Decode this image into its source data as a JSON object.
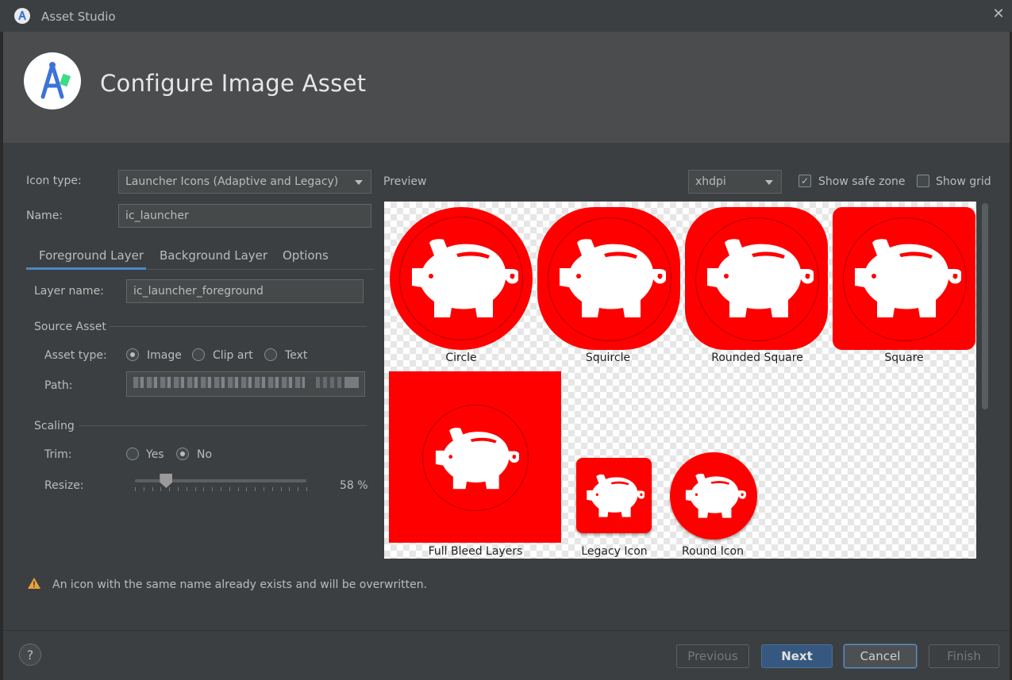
{
  "window": {
    "title": "Asset Studio",
    "close_glyph": "✕"
  },
  "header": {
    "title": "Configure Image Asset"
  },
  "form": {
    "icon_type_label": "Icon type:",
    "icon_type_value": "Launcher Icons (Adaptive and Legacy)",
    "name_label": "Name:",
    "name_value": "ic_launcher",
    "tabs": [
      "Foreground Layer",
      "Background Layer",
      "Options"
    ],
    "active_tab": "Foreground Layer",
    "layer_name_label": "Layer name:",
    "layer_name_value": "ic_launcher_foreground",
    "source_asset_title": "Source Asset",
    "asset_type_label": "Asset type:",
    "asset_type_options": [
      "Image",
      "Clip art",
      "Text"
    ],
    "asset_type_selected": "Image",
    "path_label": "Path:",
    "scaling_title": "Scaling",
    "trim_label": "Trim:",
    "trim_options": [
      "Yes",
      "No"
    ],
    "trim_selected": "No",
    "resize_label": "Resize:",
    "resize_value": 58,
    "resize_text": "58 %"
  },
  "preview": {
    "label": "Preview",
    "density": "xhdpi",
    "show_safe_zone_label": "Show safe zone",
    "show_safe_zone": true,
    "show_grid_label": "Show grid",
    "show_grid": false,
    "captions": {
      "circle": "Circle",
      "squircle": "Squircle",
      "rounded_square": "Rounded Square",
      "square": "Square",
      "full_bleed": "Full Bleed Layers",
      "legacy": "Legacy Icon",
      "round": "Round Icon"
    },
    "icon_color": "#ff0000"
  },
  "warning": {
    "text": "An icon with the same name already exists and will be overwritten.",
    "icon": "warning-icon"
  },
  "footer": {
    "help": "?",
    "previous": "Previous",
    "next": "Next",
    "cancel": "Cancel",
    "finish": "Finish"
  }
}
